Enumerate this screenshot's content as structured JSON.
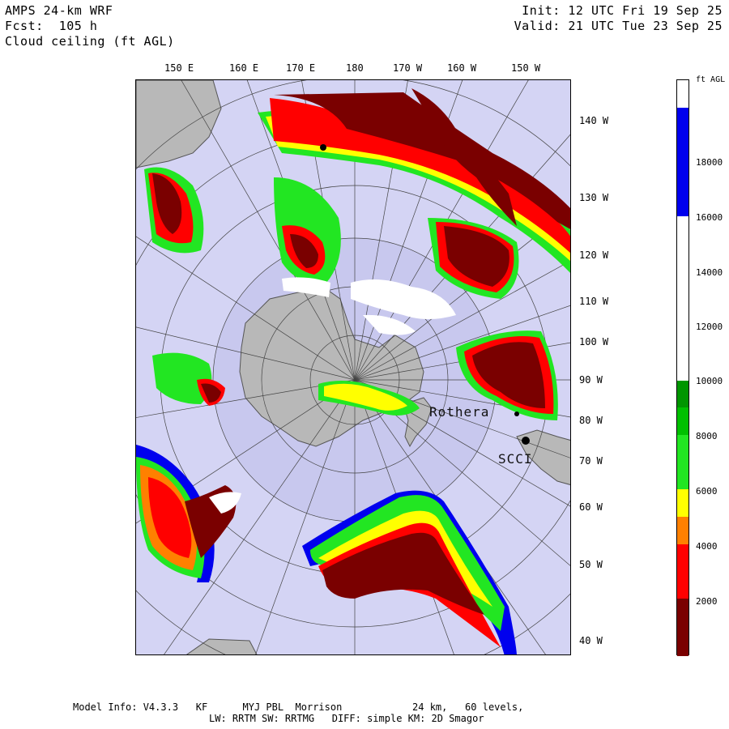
{
  "header": {
    "model": "AMPS 24-km WRF",
    "forecast": "Fcst:  105 h",
    "field": "Cloud ceiling (ft AGL)",
    "init": "Init: 12 UTC Fri 19 Sep 25",
    "valid": "Valid: 21 UTC Tue 23 Sep 25"
  },
  "map": {
    "lon_labels_top": [
      "150 E",
      "160 E",
      "170 E",
      "180",
      "170 W",
      "160 W",
      "150 W"
    ],
    "lon_labels_right": [
      "140 W",
      "130 W",
      "120 W",
      "110 W",
      "100 W",
      "90 W",
      "80 W",
      "70 W",
      "60 W",
      "50 W",
      "40 W"
    ],
    "stations": [
      {
        "name": "Rothera"
      },
      {
        "name": "SCCI"
      }
    ]
  },
  "legend": {
    "unit": "ft AGL",
    "labels": [
      "18000",
      "16000",
      "14000",
      "12000",
      "10000",
      "8000",
      "6000",
      "4000",
      "2000"
    ],
    "colors": {
      "dark_red": "#7a0000",
      "red": "#ff0000",
      "orange": "#ff8000",
      "yellow": "#ffff00",
      "light_green": "#22e622",
      "green": "#00c000",
      "dark_green": "#009600",
      "white": "#ffffff",
      "blue": "#0000ee",
      "ocean": "#d4d4f4",
      "land": "#b8b8b8",
      "ice_shelf": "#c8c8ee"
    }
  },
  "footer": {
    "line1": "Model Info: V4.3.3   KF      MYJ PBL  Morrison            24 km,   60 levels,",
    "line2": "LW: RRTM SW: RRTMG   DIFF: simple KM: 2D Smagor"
  }
}
